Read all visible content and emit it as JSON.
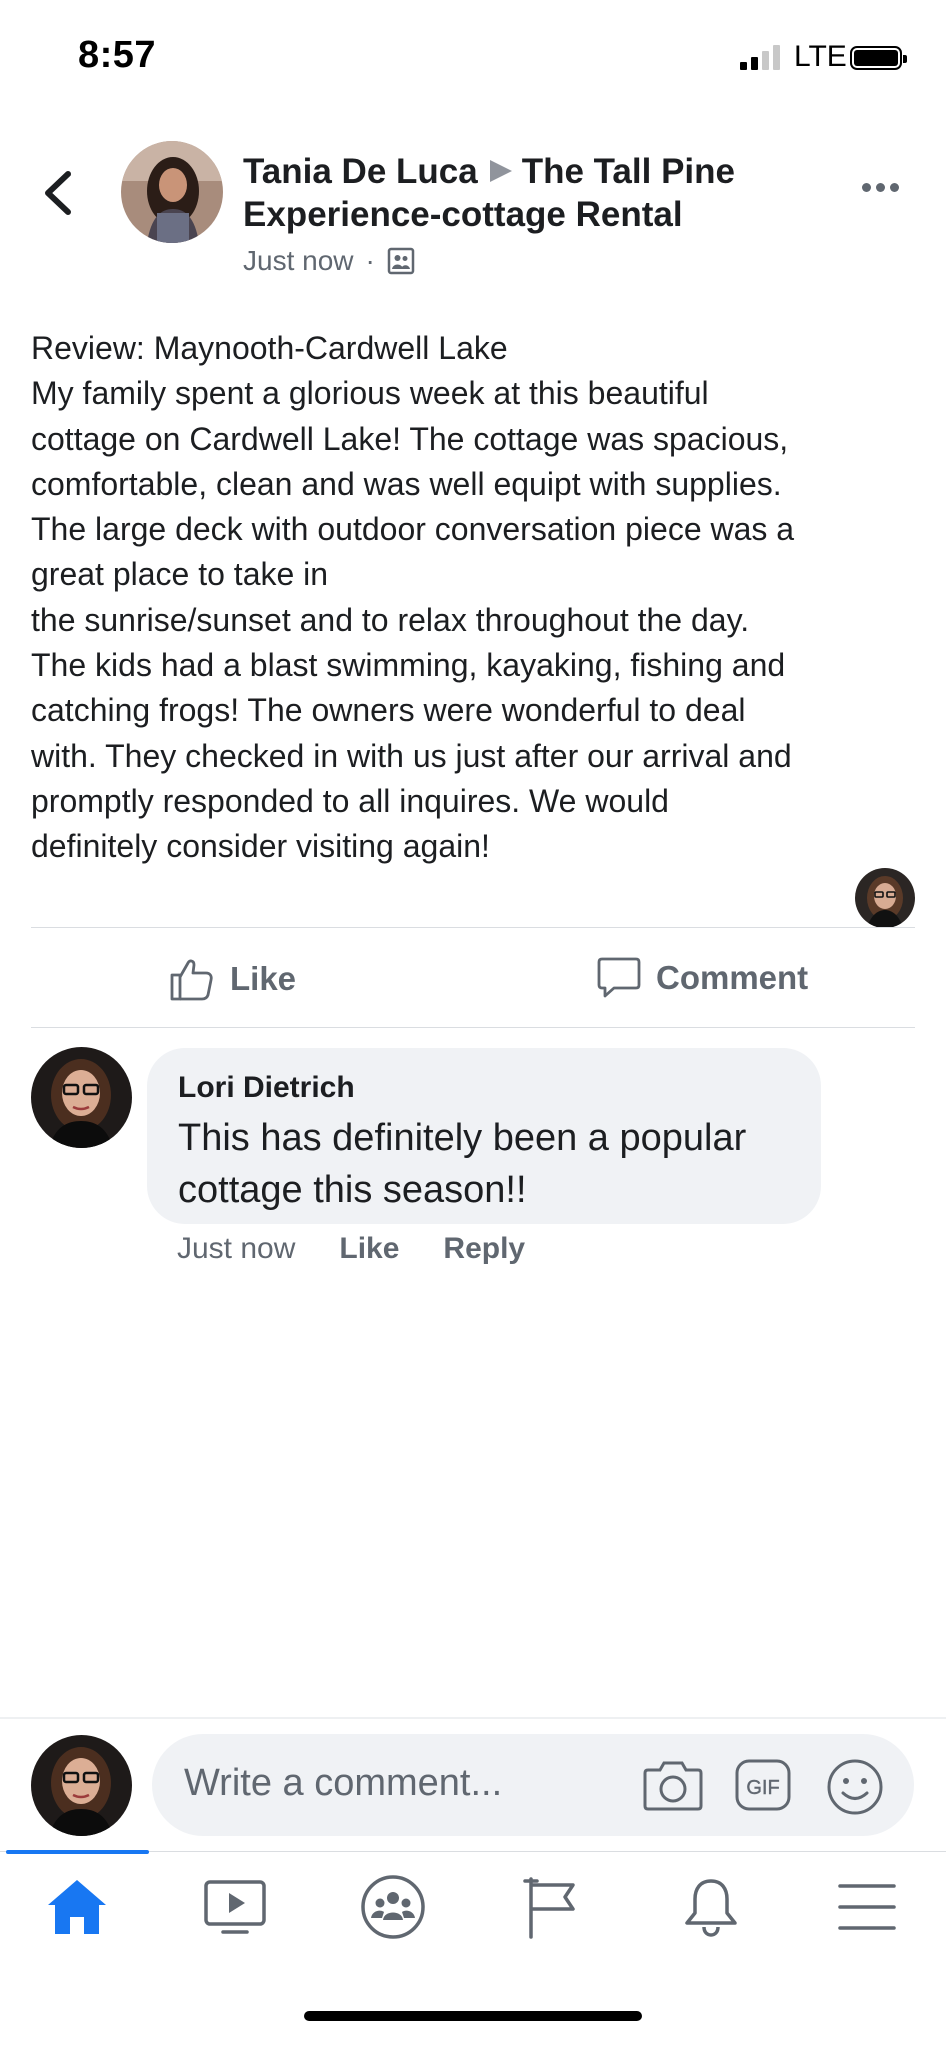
{
  "status_bar": {
    "time": "8:57",
    "network": "LTE"
  },
  "post": {
    "author": "Tania De Luca",
    "page": "The Tall Pine Experience-cottage Rental",
    "timestamp": "Just now",
    "separator": "·",
    "text_lines": [
      "Review: Maynooth-Cardwell Lake",
      "My family spent a glorious week at this beautiful",
      "cottage on Cardwell Lake! The cottage was spacious,",
      "comfortable, clean and was well equipt with supplies.",
      "The large deck with outdoor conversation piece was a",
      "great place to take in",
      "the sunrise/sunset and to relax throughout the day.",
      "The kids had a blast swimming, kayaking, fishing and",
      "catching frogs! The owners were wonderful to deal",
      "with. They checked in with us just after our arrival and",
      "promptly responded to all inquires. We would",
      "definitely consider visiting again!"
    ]
  },
  "actions": {
    "like_label": "Like",
    "comment_label": "Comment"
  },
  "comment": {
    "author": "Lori Dietrich",
    "text_lines": [
      "This has definitely been a popular",
      "cottage this season!!"
    ],
    "timestamp": "Just now",
    "like_label": "Like",
    "reply_label": "Reply"
  },
  "composer": {
    "placeholder": "Write a comment...",
    "icons": [
      "camera-icon",
      "gif-icon",
      "emoji-icon"
    ]
  },
  "tab_bar": {
    "items": [
      "home-icon",
      "watch-icon",
      "groups-icon",
      "pages-icon",
      "notifications-icon",
      "menu-icon"
    ],
    "active": "home-icon"
  },
  "colors": {
    "accent": "#1877f2",
    "secondary_text": "#606770",
    "bubble": "#f0f2f5"
  }
}
